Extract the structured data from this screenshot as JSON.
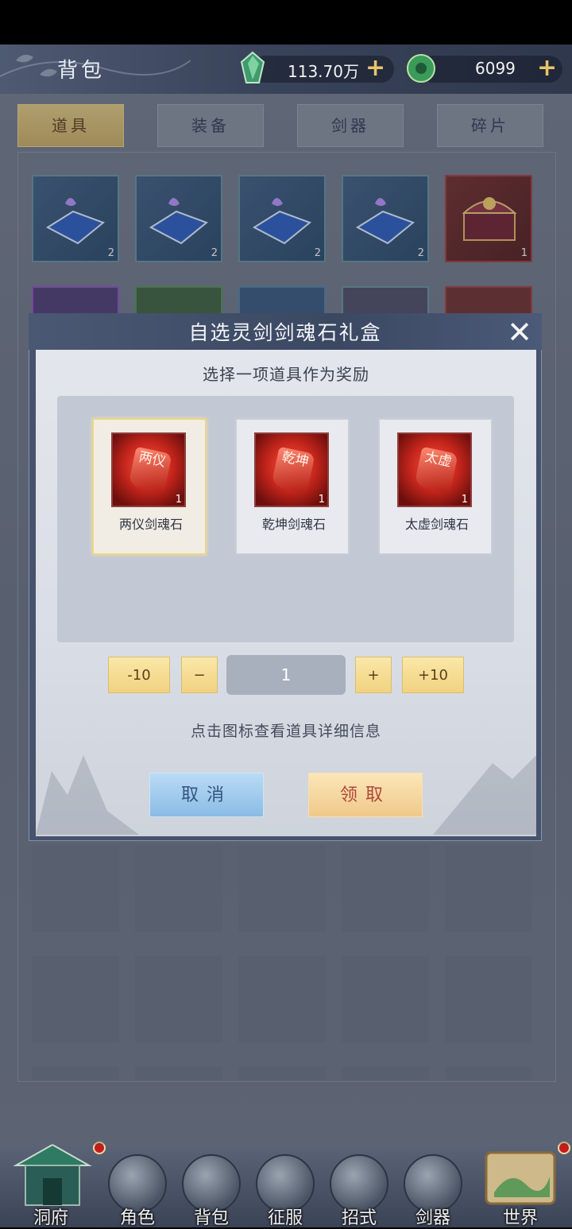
{
  "header": {
    "title": "背包",
    "currency1": {
      "icon": "jade-crystal-icon",
      "value": "113.70万"
    },
    "currency2": {
      "icon": "jade-coin-icon",
      "value": "6099"
    },
    "plus": "+"
  },
  "tabs": [
    {
      "label": "道具",
      "active": true
    },
    {
      "label": "装备",
      "active": false
    },
    {
      "label": "剑器",
      "active": false
    },
    {
      "label": "碎片",
      "active": false
    }
  ],
  "inventory": {
    "row1": [
      {
        "icon": "spellbook-icon",
        "count": "2"
      },
      {
        "icon": "spellbook-icon",
        "count": "2"
      },
      {
        "icon": "spellbook-icon",
        "count": "2"
      },
      {
        "icon": "spellbook-icon",
        "count": "2"
      },
      {
        "icon": "treasure-chest-icon",
        "count": "1"
      }
    ]
  },
  "dialog": {
    "title": "自选灵剑剑魂石礼盒",
    "close": "✕",
    "subtitle": "选择一项道具作为奖励",
    "options": [
      {
        "name": "两仪剑魂石",
        "glyph": "两仪",
        "count": "1",
        "selected": true
      },
      {
        "name": "乾坤剑魂石",
        "glyph": "乾坤",
        "count": "1",
        "selected": false
      },
      {
        "name": "太虚剑魂石",
        "glyph": "太虚",
        "count": "1",
        "selected": false
      }
    ],
    "quantity": {
      "minus10": "-10",
      "minus": "−",
      "value": "1",
      "plus": "+",
      "plus10": "+10"
    },
    "hint": "点击图标查看道具详细信息",
    "cancel": "取消",
    "confirm": "领取"
  },
  "nav": [
    {
      "label": "洞府",
      "icon": "cave-house-icon",
      "badge": true
    },
    {
      "label": "角色",
      "icon": "character-icon",
      "badge": false
    },
    {
      "label": "背包",
      "icon": "bag-icon",
      "badge": false
    },
    {
      "label": "征服",
      "icon": "crossed-swords-icon",
      "badge": false
    },
    {
      "label": "招式",
      "icon": "scroll-icon",
      "badge": false
    },
    {
      "label": "剑器",
      "icon": "sword-forge-icon",
      "badge": false
    },
    {
      "label": "世界",
      "icon": "world-map-icon",
      "badge": true
    }
  ],
  "colors": {
    "accent_gold": "#e8c56a",
    "badge_red": "#c21d1d"
  }
}
